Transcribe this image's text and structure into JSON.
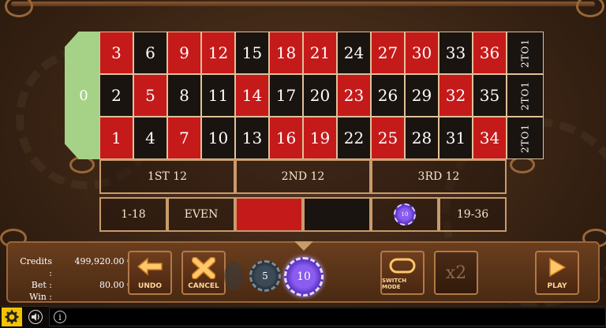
{
  "table": {
    "zero": "0",
    "rows": [
      [
        {
          "n": "3",
          "c": "red"
        },
        {
          "n": "6",
          "c": "black"
        },
        {
          "n": "9",
          "c": "red"
        },
        {
          "n": "12",
          "c": "red"
        },
        {
          "n": "15",
          "c": "black"
        },
        {
          "n": "18",
          "c": "red"
        },
        {
          "n": "21",
          "c": "red"
        },
        {
          "n": "24",
          "c": "black"
        },
        {
          "n": "27",
          "c": "red"
        },
        {
          "n": "30",
          "c": "red"
        },
        {
          "n": "33",
          "c": "black"
        },
        {
          "n": "36",
          "c": "red"
        }
      ],
      [
        {
          "n": "2",
          "c": "black"
        },
        {
          "n": "5",
          "c": "red"
        },
        {
          "n": "8",
          "c": "black"
        },
        {
          "n": "11",
          "c": "black"
        },
        {
          "n": "14",
          "c": "red"
        },
        {
          "n": "17",
          "c": "black"
        },
        {
          "n": "20",
          "c": "black"
        },
        {
          "n": "23",
          "c": "red"
        },
        {
          "n": "26",
          "c": "black"
        },
        {
          "n": "29",
          "c": "black"
        },
        {
          "n": "32",
          "c": "red"
        },
        {
          "n": "35",
          "c": "black"
        }
      ],
      [
        {
          "n": "1",
          "c": "red"
        },
        {
          "n": "4",
          "c": "black"
        },
        {
          "n": "7",
          "c": "red"
        },
        {
          "n": "10",
          "c": "black"
        },
        {
          "n": "13",
          "c": "black"
        },
        {
          "n": "16",
          "c": "red"
        },
        {
          "n": "19",
          "c": "red"
        },
        {
          "n": "22",
          "c": "black"
        },
        {
          "n": "25",
          "c": "red"
        },
        {
          "n": "28",
          "c": "black"
        },
        {
          "n": "31",
          "c": "black"
        },
        {
          "n": "34",
          "c": "red"
        }
      ]
    ],
    "column_bets": [
      "2TO1",
      "2TO1",
      "2TO1"
    ],
    "dozens": [
      "1ST 12",
      "2ND 12",
      "3RD 12"
    ],
    "outside": {
      "low": "1-18",
      "even": "EVEN",
      "red_color": "#c51a1a",
      "black_color": "#1a1410",
      "odd_chip": "10",
      "high": "19-36"
    }
  },
  "balance": {
    "credits_label": "Credits :",
    "credits_value": "499,920.00 €",
    "bet_label": "Bet :",
    "bet_value": "80.00 €",
    "win_label": "Win :",
    "win_value": ""
  },
  "controls": {
    "undo": "UNDO",
    "cancel": "CANCEL",
    "chip_5": "5",
    "chip_10": "10",
    "switch_mode": "SWITCH MODE",
    "double": "x2",
    "play": "PLAY"
  },
  "statusbar": {
    "settings_icon": "gear-icon",
    "sound_icon": "speaker-icon",
    "info_icon": "info-icon",
    "info_glyph": "i"
  },
  "colors": {
    "accent": "#8a5cf0",
    "felt_zero": "#a5d287",
    "gold": "#ffd79a"
  }
}
